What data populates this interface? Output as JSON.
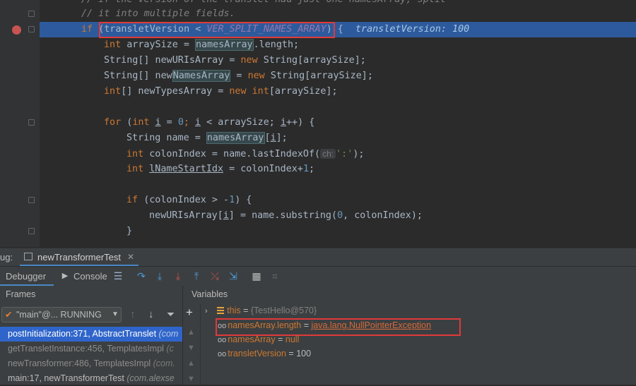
{
  "editor": {
    "lines": {
      "l0": "// if the version of the translet had just one namesArray, split",
      "l1": "// it into multiple fields.",
      "l2_if": "if ",
      "l2_open": "(",
      "l2_var": "transletVersion",
      "l2_lt": " < ",
      "l2_const": "VER_SPLIT_NAMES_ARRAY",
      "l2_close": ")",
      "l2_brace": " {",
      "l2_inline": "transletVersion: 100",
      "l3_kw": "int ",
      "l3_a": "arraySize = ",
      "l3_var": "namesArray",
      "l3_b": ".length;",
      "l4_a": "String[] newURIsArray = ",
      "l4_kw": "new ",
      "l4_b": "String[arraySize];",
      "l5_a": "String[] new",
      "l5_var": "NamesArray",
      "l5_b": " = ",
      "l5_kw": "new ",
      "l5_c": "String[arraySize];",
      "l6_kw": "int",
      "l6_a": "[] newTypesArray = ",
      "l6_kw2": "new ",
      "l6_kw3": "int",
      "l6_b": "[arraySize];",
      "l8_kw": "for ",
      "l8_a": "(",
      "l8_kw2": "int ",
      "l8_i1": "i",
      "l8_b": " = ",
      "l8_n0": "0",
      "l8_c": "; ",
      "l8_i2": "i",
      "l8_d": " < arraySize; ",
      "l8_i3": "i",
      "l8_e": "++) {",
      "l9_a": "String name = ",
      "l9_var": "namesArray",
      "l9_b": "[",
      "l9_i": "i",
      "l9_c": "];",
      "l10_kw": "int ",
      "l10_a": "colonIndex = name.lastIndexOf(",
      "l10_hint": "ch:",
      "l10_str": "':'",
      "l10_b": ");",
      "l11_kw": "int ",
      "l11_var": "lNameStartIdx",
      "l11_a": " = colonIndex+",
      "l11_n": "1",
      "l11_b": ";",
      "l13_kw": "if ",
      "l13_a": "(colonIndex > -",
      "l13_n": "1",
      "l13_b": ") {",
      "l14_a": "newURIsArray[",
      "l14_i": "i",
      "l14_b": "] = name.substring(",
      "l14_n": "0",
      "l14_c": ", colonIndex);",
      "l15": "}"
    }
  },
  "debug": {
    "title_prefix": "ug:",
    "session_tab": "newTransformerTest",
    "debugger_tab": "Debugger",
    "console_tab": "Console"
  },
  "frames": {
    "header": "Frames",
    "thread": "\"main\"@... RUNNING",
    "items": [
      {
        "method": "postInitialization:371, AbstractTranslet",
        "pkg": " (com"
      },
      {
        "method": "getTransletInstance:456, TemplatesImpl",
        "pkg": " (c"
      },
      {
        "method": "newTransformer:486, TemplatesImpl",
        "pkg": " (com."
      },
      {
        "method": "main:17, newTransformerTest",
        "pkg": " (com.alexse"
      }
    ]
  },
  "variables": {
    "header": "Variables",
    "items": [
      {
        "name": "this",
        "eq": " = ",
        "value": "{TestHello@570}"
      },
      {
        "name": "namesArray.length",
        "eq": " = ",
        "value": "java.lang.NullPointerException"
      },
      {
        "name": "namesArray",
        "eq": " = ",
        "value": "null"
      },
      {
        "name": "transletVersion",
        "eq": " = ",
        "value": "100"
      }
    ]
  },
  "colors": {
    "highlight_line": "#2d5a9c",
    "breakpoint": "#c75450",
    "annotation_box": "#e03a3a",
    "selected_frame": "#2f65ca"
  }
}
